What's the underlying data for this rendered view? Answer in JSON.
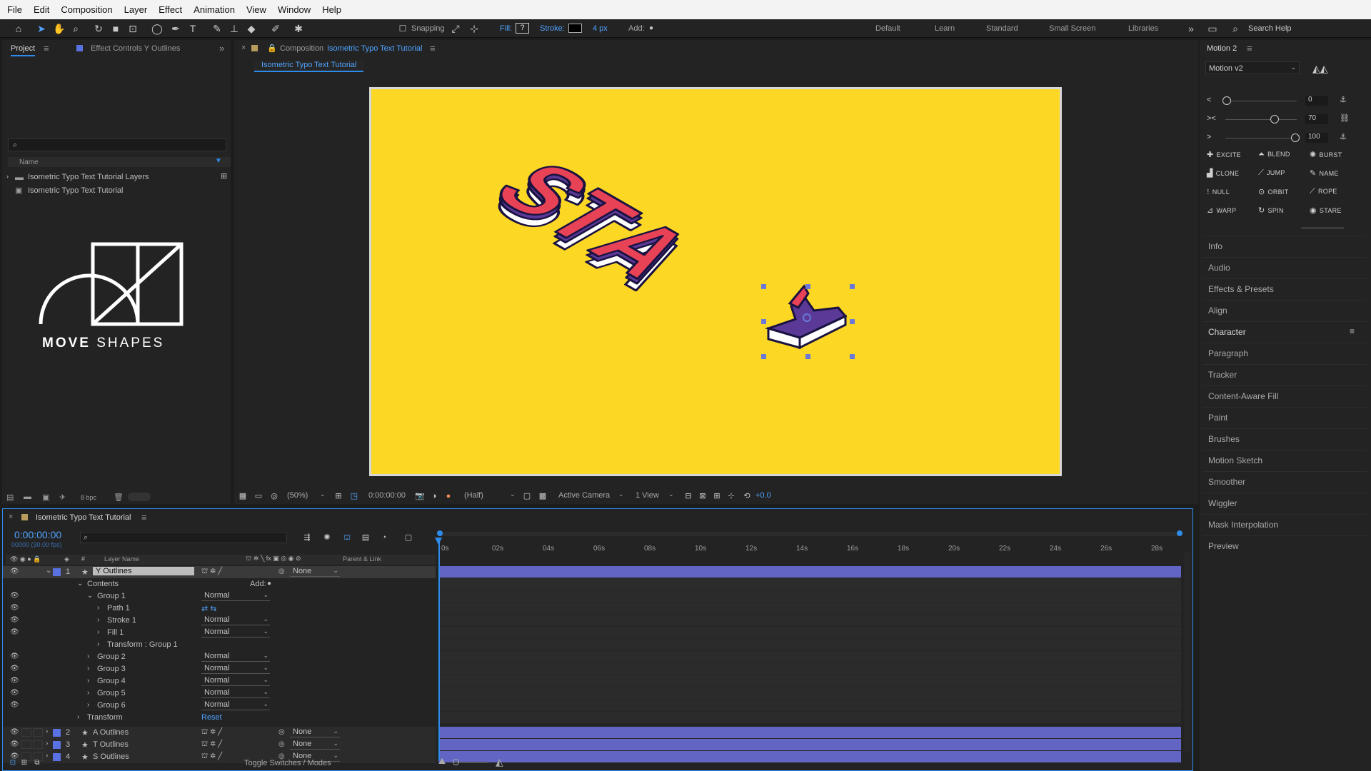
{
  "menu": [
    "File",
    "Edit",
    "Composition",
    "Layer",
    "Effect",
    "Animation",
    "View",
    "Window",
    "Help"
  ],
  "toolbar": {
    "snapping": "Snapping",
    "fill_label": "Fill:",
    "fill_value": "?",
    "stroke_label": "Stroke:",
    "stroke_width": "4 px",
    "add_label": "Add:",
    "workspaces": [
      "Default",
      "Learn",
      "Standard",
      "Small Screen",
      "Libraries"
    ],
    "search_placeholder": "Search Help"
  },
  "project": {
    "tab_project": "Project",
    "tab_effect": "Effect Controls Y Outlines",
    "col_name": "Name",
    "items": [
      "Isometric Typo Text Tutorial Layers",
      "Isometric Typo Text Tutorial"
    ],
    "logo_text_bold": "MOVE",
    "logo_text_light": "SHAPES",
    "bpc": "8 bpc"
  },
  "comp": {
    "tab_prefix": "Composition",
    "tab_name": "Isometric Typo Text Tutorial",
    "subtab": "Isometric Typo Text Tutorial",
    "zoom": "(50%)",
    "timecode": "0:00:00:00",
    "resolution": "(Half)",
    "camera": "Active Camera",
    "views": "1 View",
    "exposure": "+0.0",
    "canvas_color": "#fcd824",
    "letters": [
      "S",
      "T",
      "A",
      "Y"
    ]
  },
  "right": {
    "panel_title": "Motion 2",
    "motion_select": "Motion v2",
    "sliders": [
      {
        "icon": "<",
        "value": "0",
        "level": 0
      },
      {
        "icon": "><",
        "value": "70",
        "level": 0.7
      },
      {
        "icon": ">",
        "value": "100",
        "level": 1
      }
    ],
    "buttons": [
      "EXCITE",
      "BLEND",
      "BURST",
      "CLONE",
      "JUMP",
      "NAME",
      "NULL",
      "ORBIT",
      "ROPE",
      "WARP",
      "SPIN",
      "STARE"
    ],
    "sections": [
      "Info",
      "Audio",
      "Effects & Presets",
      "Align",
      "Character",
      "Paragraph",
      "Tracker",
      "Content-Aware Fill",
      "Paint",
      "Brushes",
      "Motion Sketch",
      "Smoother",
      "Wiggler",
      "Mask Interpolation",
      "Preview"
    ]
  },
  "timeline": {
    "tab": "Isometric Typo Text Tutorial",
    "timecode": "0:00:00:00",
    "frames": "00000 (30.00 fps)",
    "col_layer": "Layer Name",
    "col_parent": "Parent & Link",
    "ticks": [
      "0s",
      "02s",
      "04s",
      "06s",
      "08s",
      "10s",
      "12s",
      "14s",
      "16s",
      "18s",
      "20s",
      "22s",
      "24s",
      "26s",
      "28s"
    ],
    "add_label": "Add:",
    "reset_label": "Reset",
    "toggle_label": "Toggle Switches / Modes",
    "rows": [
      {
        "num": "1",
        "name": "Y Outlines",
        "indent": 0,
        "type": "layer",
        "parent": "None"
      },
      {
        "name": "Contents",
        "indent": 1,
        "type": "prop"
      },
      {
        "name": "Group 1",
        "indent": 2,
        "type": "group",
        "mode": "Normal"
      },
      {
        "name": "Path 1",
        "indent": 3,
        "type": "path"
      },
      {
        "name": "Stroke 1",
        "indent": 3,
        "type": "group",
        "mode": "Normal"
      },
      {
        "name": "Fill 1",
        "indent": 3,
        "type": "group",
        "mode": "Normal"
      },
      {
        "name": "Transform : Group 1",
        "indent": 3,
        "type": "prop"
      },
      {
        "name": "Group 2",
        "indent": 2,
        "type": "group",
        "mode": "Normal"
      },
      {
        "name": "Group 3",
        "indent": 2,
        "type": "group",
        "mode": "Normal"
      },
      {
        "name": "Group 4",
        "indent": 2,
        "type": "group",
        "mode": "Normal"
      },
      {
        "name": "Group 5",
        "indent": 2,
        "type": "group",
        "mode": "Normal"
      },
      {
        "name": "Group 6",
        "indent": 2,
        "type": "group",
        "mode": "Normal"
      },
      {
        "name": "Transform",
        "indent": 1,
        "type": "reset"
      },
      {
        "num": "2",
        "name": "A Outlines",
        "indent": 0,
        "type": "layer",
        "parent": "None"
      },
      {
        "num": "3",
        "name": "T Outlines",
        "indent": 0,
        "type": "layer",
        "parent": "None"
      },
      {
        "num": "4",
        "name": "S Outlines",
        "indent": 0,
        "type": "layer",
        "parent": "None"
      }
    ]
  }
}
